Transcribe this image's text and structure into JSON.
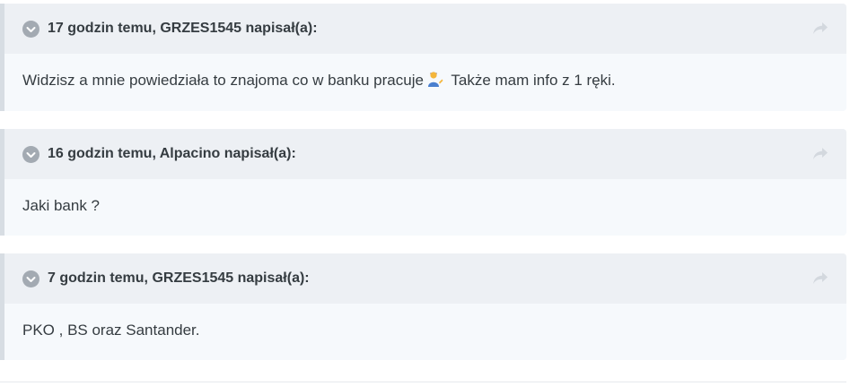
{
  "quotes": [
    {
      "citation": "17 godzin temu, GRZES1545 napisał(a):",
      "text_before_emoji": "Widzisz a mnie powiedziała to znajoma co w banku pracuje",
      "emoji": "person-tipping-hand-emoji",
      "text_after_emoji": " Także mam info z 1 ręki."
    },
    {
      "citation": "16 godzin temu, Alpacino napisał(a):",
      "text": "Jaki bank ?"
    },
    {
      "citation": "7 godzin temu, GRZES1545 napisał(a):",
      "text": "PKO , BS oraz Santander."
    }
  ],
  "icons": {
    "toggle": "chevron-down-circle-icon",
    "share": "share-arrow-icon"
  },
  "colors": {
    "header_bg": "#edf0f4",
    "body_bg": "#f6f9fc",
    "border_left": "#d7dde3",
    "text": "#353c41",
    "icon": "#a3aab2"
  }
}
